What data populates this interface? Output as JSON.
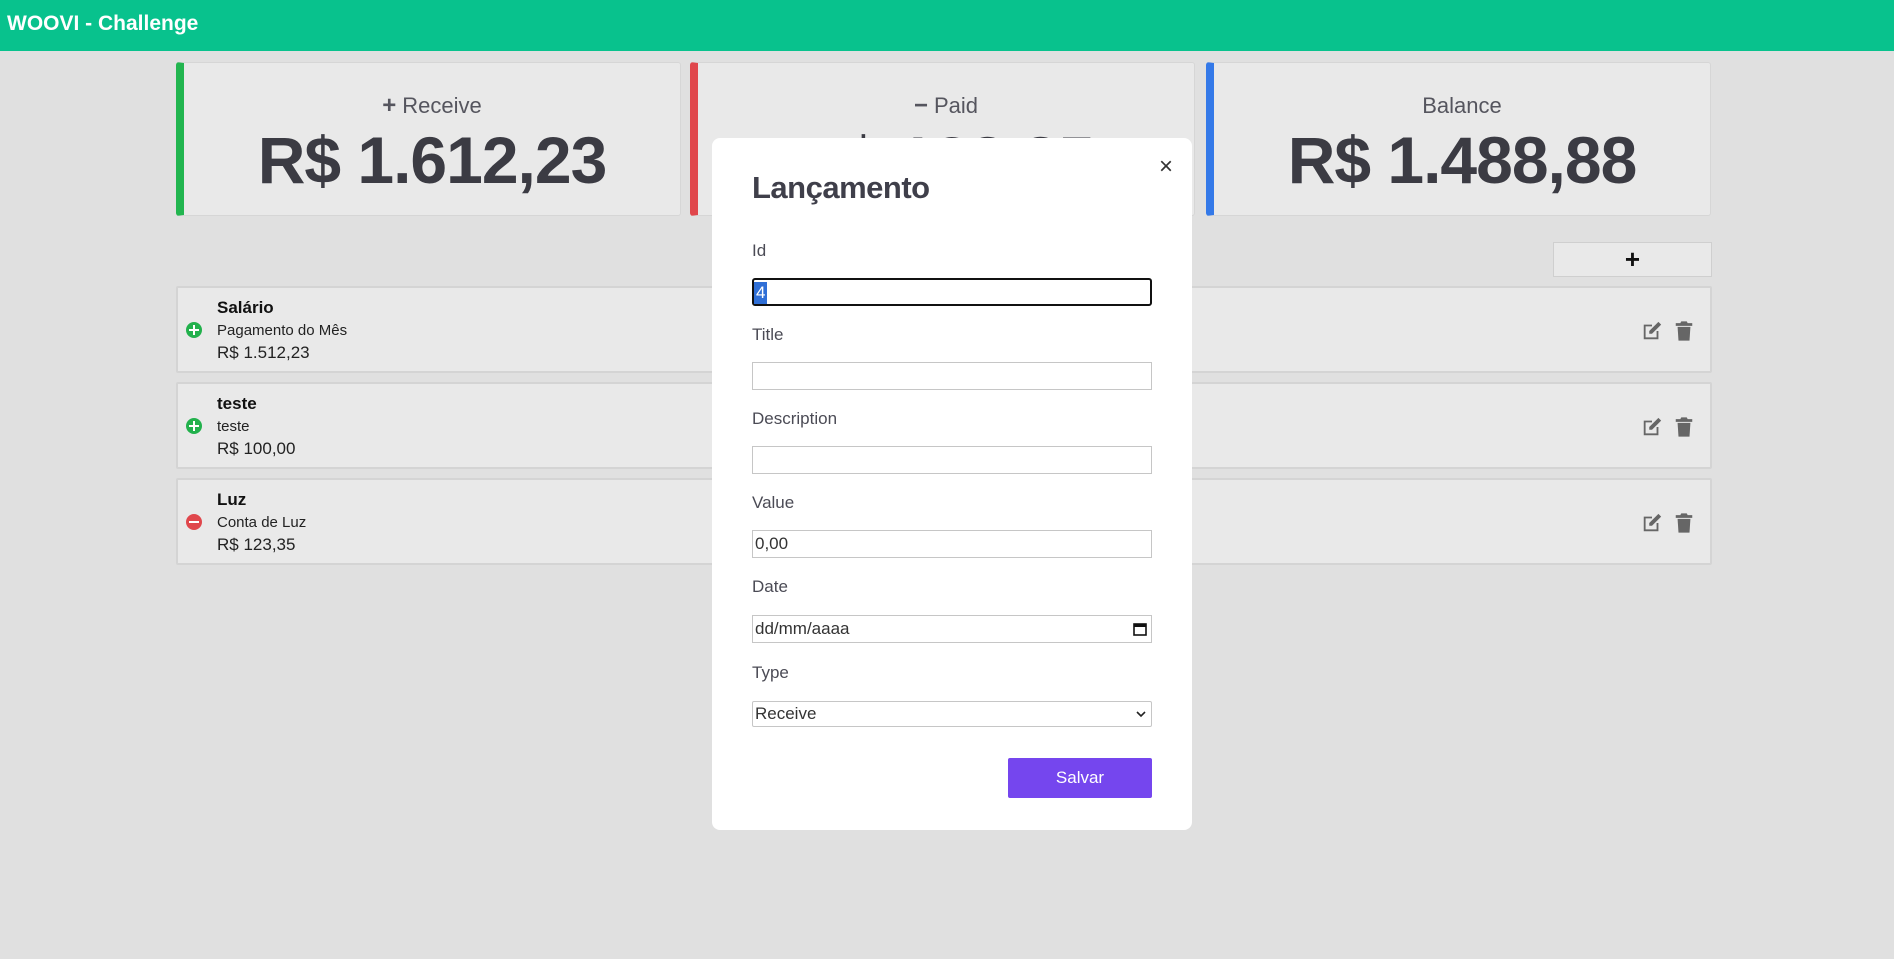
{
  "app": {
    "title": "WOOVI - Challenge",
    "brand_color": "#08c28d"
  },
  "summary": {
    "receive": {
      "sign": "+",
      "label": "Receive",
      "amount": "R$ 1.612,23",
      "color": "#22b54f"
    },
    "paid": {
      "sign": "−",
      "label": "Paid",
      "amount": "R$ 123,35",
      "color": "#e0474c"
    },
    "balance": {
      "label": "Balance",
      "amount": "R$ 1.488,88",
      "color": "#3479e8"
    }
  },
  "toolbar": {
    "add_label": "+"
  },
  "entries": [
    {
      "title": "Salário",
      "description": "Pagamento do Mês",
      "value": "R$ 1.512,23",
      "type": "receive",
      "icon": "plus-circle-icon"
    },
    {
      "title": "teste",
      "description": "teste",
      "value": "R$ 100,00",
      "type": "receive",
      "icon": "plus-circle-icon"
    },
    {
      "title": "Luz",
      "description": "Conta de Luz",
      "value": "R$ 123,35",
      "type": "paid",
      "icon": "minus-circle-icon"
    }
  ],
  "modal": {
    "title": "Lançamento",
    "close_label": "×",
    "fields": {
      "id": {
        "label": "Id",
        "value": "4"
      },
      "title": {
        "label": "Title",
        "value": ""
      },
      "description": {
        "label": "Description",
        "value": ""
      },
      "value": {
        "label": "Value",
        "value": "0,00"
      },
      "date": {
        "label": "Date",
        "placeholder": "dd/mm/aaaa"
      },
      "type": {
        "label": "Type",
        "selected": "Receive"
      }
    },
    "save_label": "Salvar",
    "save_color": "#7546ee"
  }
}
